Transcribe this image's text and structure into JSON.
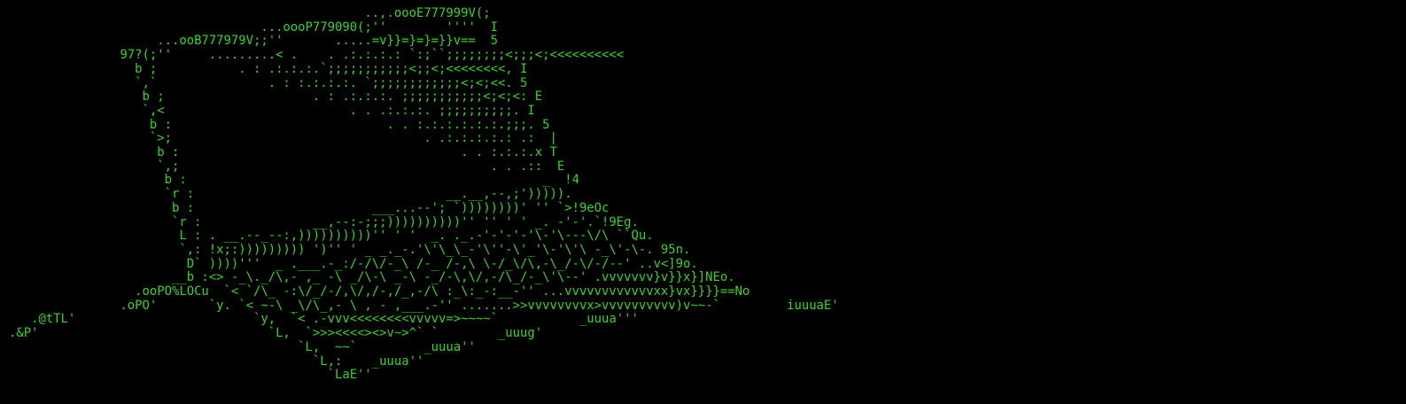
{
  "colors": {
    "background": "#000000",
    "text": "#39d32a"
  },
  "ascii_art": "                                                ..,.oooE777999V(;\n                                  ...oooP779090(;''        ''''  I\n                    ...ooB777979V;;''       .....=v}}=}=}=}}v==  5\n               97?(;''     .........< .    . .:.:.:.: `:;``;;;;;;;;<;;;<;<<<<<<<<<<\n                 b ;           . : .:.:.:.`;;;;;;;;;;;<;;<;<<<<<<<<, I\n                 `,`               . : :.:.:.:. `;;;;;;;;;;;;<;<;<<. 5\n                  b ;                    . : .:.:.:. ;;;;;;;;;;;<;<;<: E\n                  `,<                         . . .:.:.:. ;;;;;;;;;;. I\n                   b :                             . . :.:.:.:.:.:.;;;. 5\n                   `>;                                  . .:.:.:.:.: .:  |\n                    b :                                      . . :.:.:.x T\n                    `,;                                          . . .::  E\n                     b :                                                _  !4\n                     `r :                                  __.__,--,;'))))).\n                      b :                        ___...--'; `))))))))' '' `>!9eOc\n                      `r :               __,--:-;;;))))))))))'' '' ' ' _. -'-'.`!9Eg.\n                       L : . __.--_--:,))))))))))'' ' '  _. ._.-'-'-'-'\\-'\\---\\/\\ ``Qu.\n                       `,: !x;:))))))))) ')'' ' _ _._-.'\\'\\_\\_-'\\''-\\'_'\\-'\\'\\ -_\\'-\\-. 95n.\n                        D` ))))'''  _ .___.-_:/-/\\/-_\\ /-_ /-,\\ \\-/_\\/\\,-\\_/-\\/-/--' ..v<]9o.\n                      __b :<> -_\\._/\\,- ,_ -\\ _/\\-\\ _-\\ -_/-\\,\\/,-/\\_/-_\\'\\--' .vvvvvvv}v}}x}]NEo.\n                 .ooPO%LOCu  `< `/\\_ -:\\/_/-/,\\/,/-,/_,-/\\ :_\\:_-:__-'' ...vvvvvvvvvvvvxx}vx}}}}==No\n               .oPO'       `y. `< ~-\\ _\\/\\_,- \\ , - ,___.-'' .......>>vvvvvvvvx>vvvvvvvvvv)v~~-`         iuuuaE'\n   .@tTL'                        `y,  `< .-vvv<<<<<<<<vvvvv=>~~~~`           _uuua'''\n.&P'                               `L,  `>>><<<<><>v~>^` `        _uuug'\n                                       `L,  ~~`         _uuua''\n                                         `L,:    _uuua''\n                                           `LaE''"
}
